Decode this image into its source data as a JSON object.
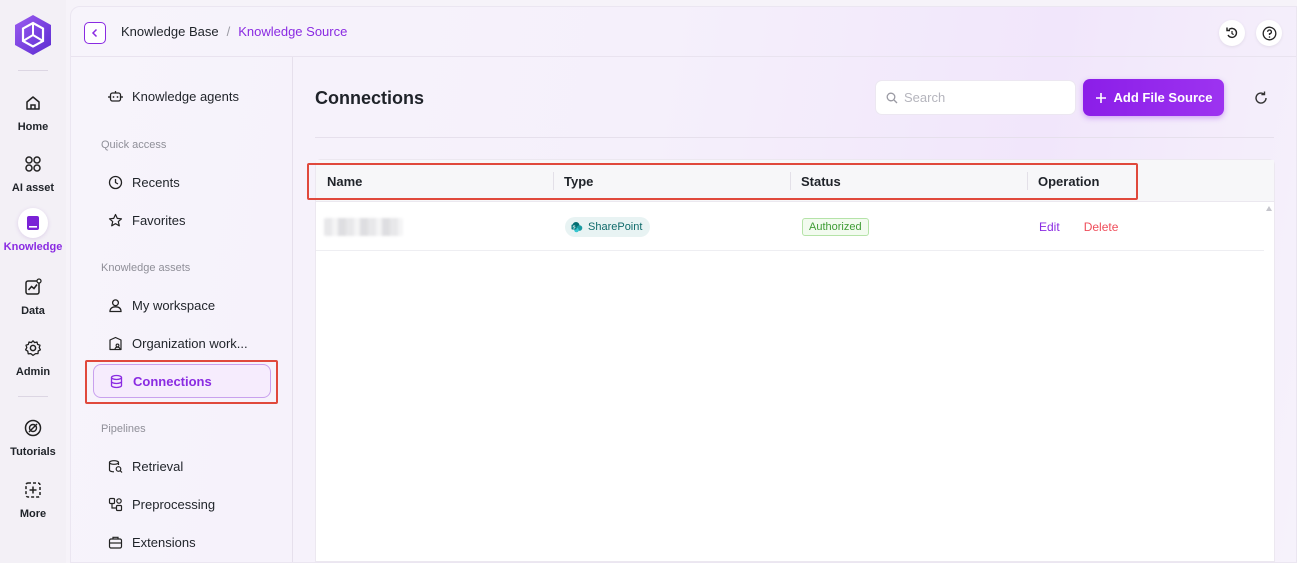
{
  "rail": {
    "items": [
      {
        "label": "Home",
        "icon": "home-icon"
      },
      {
        "label": "AI asset",
        "icon": "ai-asset-icon"
      },
      {
        "label": "Knowledge",
        "icon": "knowledge-book-icon",
        "active": true
      },
      {
        "label": "Data",
        "icon": "data-chart-icon"
      },
      {
        "label": "Admin",
        "icon": "gear-icon"
      },
      {
        "label": "Tutorials",
        "icon": "tutorials-icon"
      },
      {
        "label": "More",
        "icon": "more-plus-icon"
      }
    ]
  },
  "header": {
    "breadcrumb": [
      "Knowledge Base",
      "Knowledge Source"
    ],
    "separator": "/"
  },
  "subnav": {
    "knowledge_agents": "Knowledge agents",
    "quick_access_title": "Quick access",
    "recents": "Recents",
    "favorites": "Favorites",
    "knowledge_assets_title": "Knowledge assets",
    "my_workspace": "My workspace",
    "organization_workspace": "Organization work...",
    "connections": "Connections",
    "pipelines_title": "Pipelines",
    "retrieval": "Retrieval",
    "preprocessing": "Preprocessing",
    "extensions": "Extensions"
  },
  "main": {
    "title": "Connections",
    "search_placeholder": "Search",
    "add_button": "Add File Source",
    "table": {
      "columns": [
        "Name",
        "Type",
        "Status",
        "Operation"
      ],
      "rows": [
        {
          "name": "",
          "type": "SharePoint",
          "status": "Authorized",
          "ops": [
            "Edit",
            "Delete"
          ]
        }
      ]
    }
  },
  "colors": {
    "accent": "#8a2be2",
    "highlight_box": "#e0493c",
    "delete": "#ef4d5a",
    "status_ok": "#3f9c35"
  }
}
